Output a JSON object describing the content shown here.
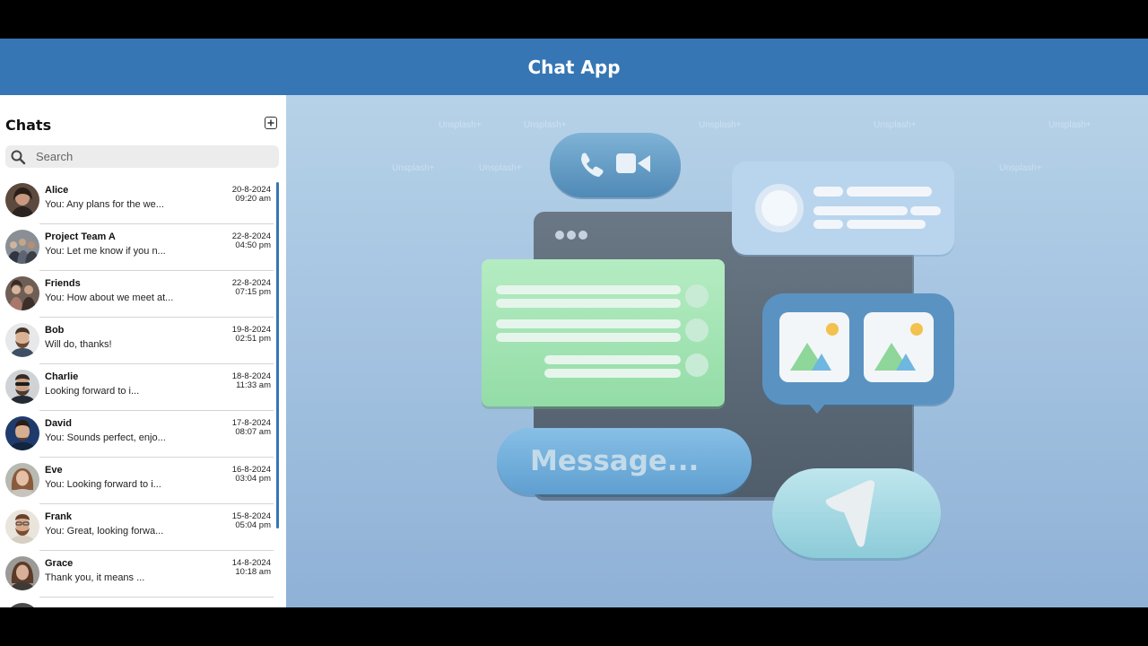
{
  "app": {
    "title": "Chat App"
  },
  "sidebar": {
    "title": "Chats",
    "new_chat_icon": "new-chat-icon",
    "search": {
      "placeholder": "Search",
      "value": "",
      "icon": "search-icon"
    },
    "chats": [
      {
        "name": "Alice",
        "preview": "You: Any plans for the we...",
        "date": "20-8-2024",
        "time": "09:20 am"
      },
      {
        "name": "Project Team A",
        "preview": "You: Let me know if you n...",
        "date": "22-8-2024",
        "time": "04:50 pm"
      },
      {
        "name": "Friends",
        "preview": "You: How about we meet at...",
        "date": "22-8-2024",
        "time": "07:15 pm"
      },
      {
        "name": "Bob",
        "preview": "Will do, thanks!",
        "date": "19-8-2024",
        "time": "02:51 pm"
      },
      {
        "name": "Charlie",
        "preview": "Looking forward to i...",
        "date": "18-8-2024",
        "time": "11:33 am"
      },
      {
        "name": "David",
        "preview": "You: Sounds perfect, enjo...",
        "date": "17-8-2024",
        "time": "08:07 am"
      },
      {
        "name": "Eve",
        "preview": "You: Looking forward to i...",
        "date": "16-8-2024",
        "time": "03:04 pm"
      },
      {
        "name": "Frank",
        "preview": "You: Great, looking forwa...",
        "date": "15-8-2024",
        "time": "05:04 pm"
      },
      {
        "name": "Grace",
        "preview": "Thank you, it means ...",
        "date": "14-8-2024",
        "time": "10:18 am"
      }
    ]
  },
  "main": {
    "illustration": {
      "message_placeholder": "Message...",
      "watermark": "Unsplash+"
    }
  },
  "colors": {
    "header": "#3676b4",
    "accent": "#3676b4",
    "main_bg": "#a3c2e0"
  }
}
